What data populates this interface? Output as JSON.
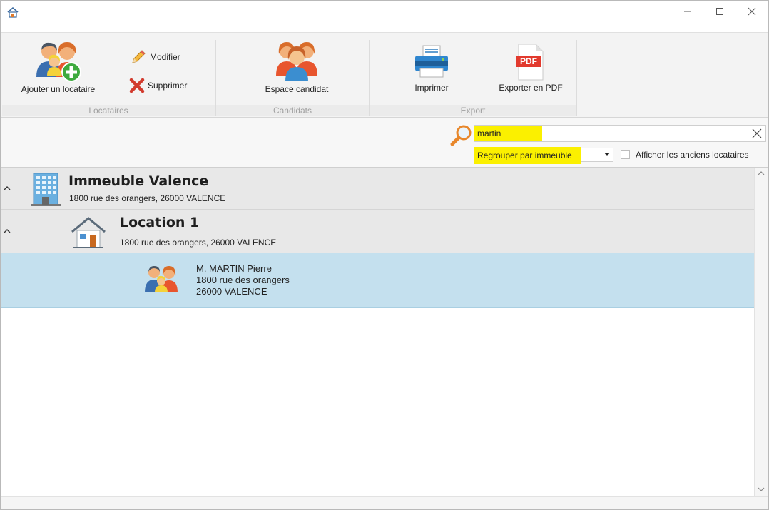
{
  "ribbon": {
    "add_tenant_label": "Ajouter un locataire",
    "modify_label": "Modifier",
    "delete_label": "Supprimer",
    "candidate_space_label": "Espace candidat",
    "print_label": "Imprimer",
    "export_pdf_label": "Exporter en PDF",
    "pdf_icon_text": "PDF",
    "groups": {
      "tenants": "Locataires",
      "candidates": "Candidats",
      "export": "Export"
    }
  },
  "filters": {
    "search_value": "martin",
    "group_by_value": "Regrouper par immeuble",
    "show_former_label": "Afficher les anciens locataires",
    "highlight_color": "#fbf000"
  },
  "list": {
    "building": {
      "name": "Immeuble Valence",
      "address": "1800 rue des orangers, 26000 VALENCE"
    },
    "location": {
      "name": "Location 1",
      "address": "1800 rue des orangers, 26000 VALENCE"
    },
    "tenant": {
      "name": "M. MARTIN Pierre",
      "street": "1800 rue des orangers",
      "city": "26000 VALENCE"
    }
  },
  "colors": {
    "selected_row": "#c4e0ee",
    "group_row": "#e8e8e8"
  }
}
